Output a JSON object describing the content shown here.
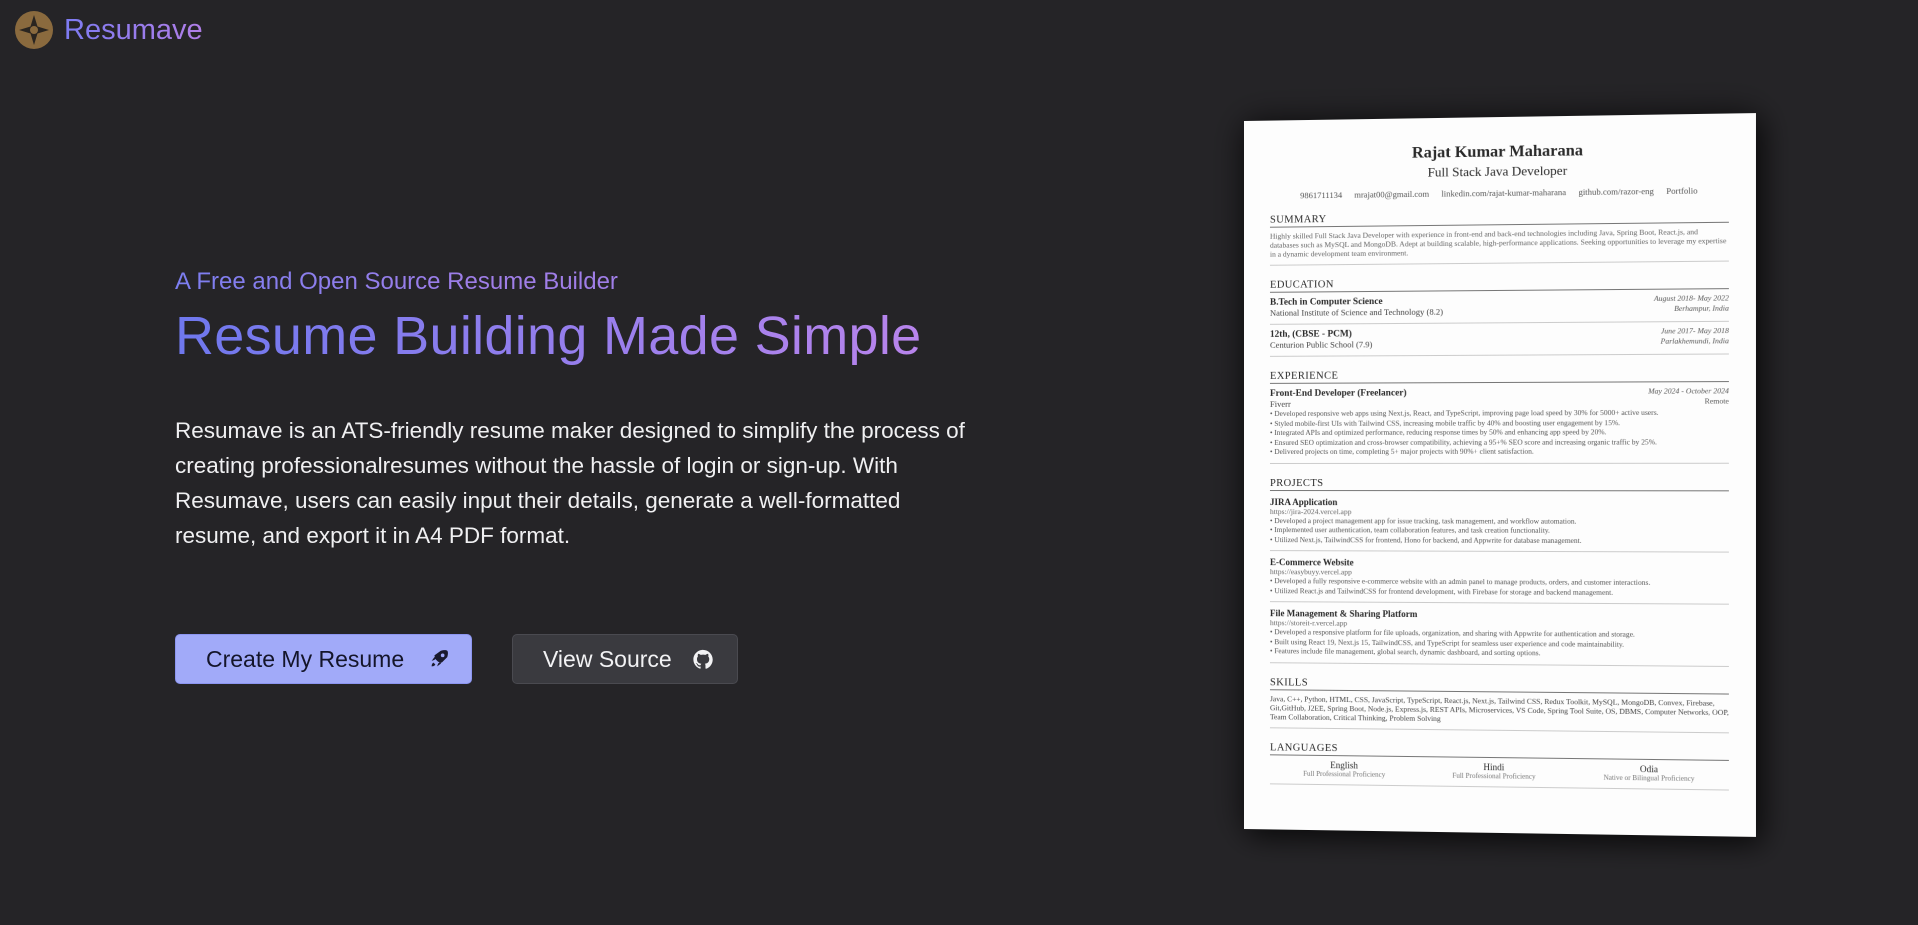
{
  "brand": {
    "name": "Resumave",
    "logo_icon": "compass-star-icon"
  },
  "hero": {
    "tagline": "A Free and Open Source Resume Builder",
    "headline": "Resume Building Made Simple",
    "description": "Resumave is an ATS-friendly resume maker designed to simplify the process of creating professionalresumes without the hassle of login or sign-up. With Resumave, users can easily input their details, generate a well-formatted resume, and export it in A4 PDF format."
  },
  "buttons": {
    "primary_label": "Create My Resume",
    "primary_icon": "rocket-icon",
    "secondary_label": "View Source",
    "secondary_icon": "github-icon"
  },
  "colors": {
    "background": "#252427",
    "accent_start": "#6f78ee",
    "accent_end": "#b884ec",
    "primary_button": "#a1aaf9",
    "secondary_button": "#3a3a3f"
  },
  "resume": {
    "name": "Rajat Kumar Maharana",
    "role": "Full Stack Java Developer",
    "contacts": [
      "9861711134",
      "mrajat00@gmail.com",
      "linkedin.com/rajat-kumar-maharana",
      "github.com/razor-eng",
      "Portfolio"
    ],
    "summary_title": "SUMMARY",
    "summary": "Highly skilled Full Stack Java Developer with experience in front-end and back-end technologies including Java, Spring Boot, React.js, and databases such as MySQL and MongoDB. Adept at building scalable, high-performance applications. Seeking opportunities to leverage my expertise in a dynamic development team environment.",
    "education_title": "EDUCATION",
    "education": [
      {
        "degree": "B.Tech in Computer Science",
        "school": "National Institute of Science and Technology (8.2)",
        "dates": "August 2018- May 2022",
        "place": "Berhampur, India"
      },
      {
        "degree": "12th, (CBSE - PCM)",
        "school": "Centurion Public School (7.9)",
        "dates": "June 2017- May 2018",
        "place": "Parlakhemundi, India"
      }
    ],
    "experience_title": "EXPERIENCE",
    "experience": {
      "title": "Front-End Developer (Freelancer)",
      "company": "Fiverr",
      "dates": "May 2024 - October 2024",
      "location": "Remote",
      "bullets": [
        "• Developed responsive web apps using Next.js, React, and TypeScript, improving page load speed by 30% for 5000+ active users.",
        "• Styled mobile-first UIs with Tailwind CSS, increasing mobile traffic by 40% and boosting user engagement by 15%.",
        "• Integrated APIs and optimized performance, reducing response times by 50% and enhancing app speed by 20%.",
        "• Ensured SEO optimization and cross-browser compatibility, achieving a 95+% SEO score and increasing organic traffic by 25%.",
        "• Delivered projects on time, completing 5+ major projects with 90%+ client satisfaction."
      ]
    },
    "projects_title": "PROJECTS",
    "projects": [
      {
        "title": "JIRA Application",
        "link": "https://jira-2024.vercel.app",
        "bullets": [
          "• Developed a project management app for issue tracking, task management, and workflow automation.",
          "• Implemented user authentication, team collaboration features, and task creation functionality.",
          "• Utilized Next.js, TailwindCSS for frontend, Hono for backend, and Appwrite for database management."
        ]
      },
      {
        "title": "E-Commerce Website",
        "link": "https://easybuyy.vercel.app",
        "bullets": [
          "• Developed a fully responsive e-commerce website with an admin panel to manage products, orders, and customer interactions.",
          "• Utilized React.js and TailwindCSS for frontend development, with Firebase for storage and backend management."
        ]
      },
      {
        "title": "File Management & Sharing Platform",
        "link": "https://storeit-r.vercel.app",
        "bullets": [
          "• Developed a responsive platform for file uploads, organization, and sharing with Appwrite for authentication and storage.",
          "• Built using React 19, Next.js 15, TailwindCSS, and TypeScript for seamless user experience and code maintainability.",
          "• Features include file management, global search, dynamic dashboard, and sorting options."
        ]
      }
    ],
    "skills_title": "SKILLS",
    "skills": "Java, C++, Python, HTML, CSS, JavaScript, TypeScript, React.js, Next.js, Tailwind CSS, Redux Toolkit, MySQL, MongoDB, Convex, Firebase, Git,GitHub, J2EE, Spring Boot, Node.js, Express.js, REST APIs, Microservices, VS Code, Spring Tool Suite, OS, DBMS, Computer Networks, OOP, Team Collaboration, Critical Thinking, Problem Solving",
    "languages_title": "LANGUAGES",
    "languages": [
      {
        "name": "English",
        "level": "Full Professional Proficiency"
      },
      {
        "name": "Hindi",
        "level": "Full Professional Proficiency"
      },
      {
        "name": "Odia",
        "level": "Native or Bilingual Proficiency"
      }
    ]
  }
}
